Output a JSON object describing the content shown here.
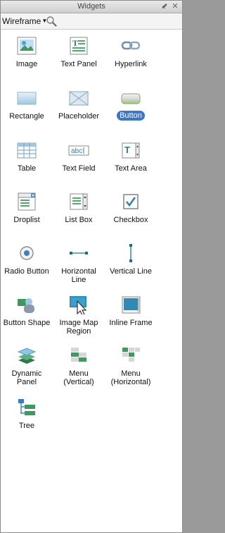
{
  "window": {
    "title": "Widgets",
    "minimize_glyph": "⬋",
    "close_glyph": "✕"
  },
  "toolbar": {
    "library": "Wireframe",
    "search_icon": "magnifier-icon"
  },
  "widgets": [
    {
      "label": "Image",
      "icon": "image-icon"
    },
    {
      "label": "Text Panel",
      "icon": "text-panel-icon"
    },
    {
      "label": "Hyperlink",
      "icon": "hyperlink-icon"
    },
    {
      "label": "Rectangle",
      "icon": "rectangle-icon"
    },
    {
      "label": "Placeholder",
      "icon": "placeholder-icon"
    },
    {
      "label": "Button",
      "icon": "button-icon",
      "selected": true
    },
    {
      "label": "Table",
      "icon": "table-icon"
    },
    {
      "label": "Text Field",
      "icon": "text-field-icon"
    },
    {
      "label": "Text Area",
      "icon": "text-area-icon"
    },
    {
      "label": "Droplist",
      "icon": "droplist-icon"
    },
    {
      "label": "List Box",
      "icon": "list-box-icon"
    },
    {
      "label": "Checkbox",
      "icon": "checkbox-icon"
    },
    {
      "label": "Radio Button",
      "icon": "radio-button-icon"
    },
    {
      "label": "Horizontal\nLine",
      "icon": "horizontal-line-icon"
    },
    {
      "label": "Vertical Line",
      "icon": "vertical-line-icon"
    },
    {
      "label": "Button Shape",
      "icon": "button-shape-icon"
    },
    {
      "label": "Image Map\nRegion",
      "icon": "image-map-region-icon"
    },
    {
      "label": "Inline Frame",
      "icon": "inline-frame-icon"
    },
    {
      "label": "Dynamic\nPanel",
      "icon": "dynamic-panel-icon"
    },
    {
      "label": "Menu\n(Vertical)",
      "icon": "menu-vertical-icon"
    },
    {
      "label": "Menu\n(Horizontal)",
      "icon": "menu-horizontal-icon"
    },
    {
      "label": "Tree",
      "icon": "tree-icon"
    }
  ],
  "colors": {
    "selection": "#3b75d0",
    "accent_green": "#3c9a60",
    "accent_blue": "#2f7fc9"
  }
}
